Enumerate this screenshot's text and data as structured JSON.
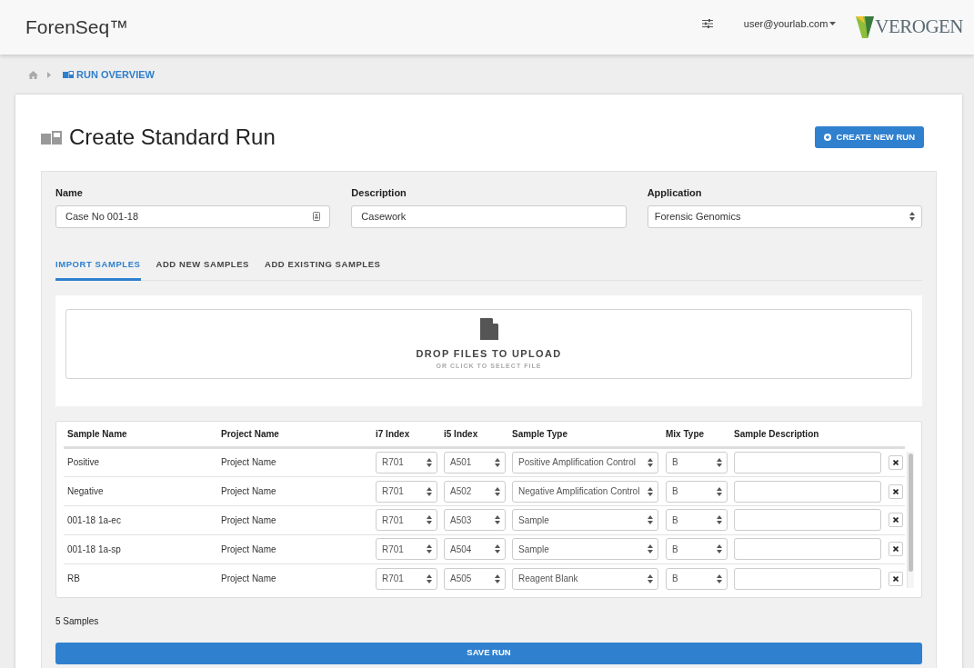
{
  "header": {
    "brand": "ForenSeq™",
    "user": "user@yourlab.com",
    "logo": "VEROGEN"
  },
  "breadcrumb": {
    "current": "RUN OVERVIEW"
  },
  "page": {
    "title": "Create Standard Run",
    "action": "CREATE NEW RUN"
  },
  "fields": [
    {
      "label": "Name",
      "value": "Case No 001-18",
      "kind": "contact"
    },
    {
      "label": "Description",
      "value": "Casework",
      "kind": "text"
    },
    {
      "label": "Application",
      "value": "Forensic Genomics",
      "kind": "select"
    }
  ],
  "tabs": [
    {
      "label": "IMPORT SAMPLES",
      "selected": true
    },
    {
      "label": "ADD NEW SAMPLES",
      "selected": false
    },
    {
      "label": "ADD EXISTING SAMPLES",
      "selected": false
    }
  ],
  "dropzone": {
    "title": "DROP FILES TO UPLOAD",
    "subtitle": "OR CLICK TO SELECT FILE"
  },
  "table": {
    "columns": [
      "Sample Name",
      "Project Name",
      "i7 Index",
      "i5 Index",
      "Sample Type",
      "Mix Type",
      "Sample Description"
    ],
    "rows": [
      {
        "sample_name": "Positive",
        "project_name": "Project Name",
        "i7_index": "R701",
        "i5_index": "A501",
        "sample_type": "Positive Amplification Control",
        "mix_type": "B"
      },
      {
        "sample_name": "Negative",
        "project_name": "Project Name",
        "i7_index": "R701",
        "i5_index": "A502",
        "sample_type": "Negative Amplification Control",
        "mix_type": "B"
      },
      {
        "sample_name": "001-18 1a-ec",
        "project_name": "Project Name",
        "i7_index": "R701",
        "i5_index": "A503",
        "sample_type": "Sample",
        "mix_type": "B"
      },
      {
        "sample_name": "001-18 1a-sp",
        "project_name": "Project Name",
        "i7_index": "R701",
        "i5_index": "A504",
        "sample_type": "Sample",
        "mix_type": "B"
      },
      {
        "sample_name": "RB",
        "project_name": "Project Name",
        "i7_index": "R701",
        "i5_index": "A505",
        "sample_type": "Reagent Blank",
        "mix_type": "B"
      }
    ]
  },
  "sample_count": "5 Samples",
  "save_button": "SAVE RUN"
}
